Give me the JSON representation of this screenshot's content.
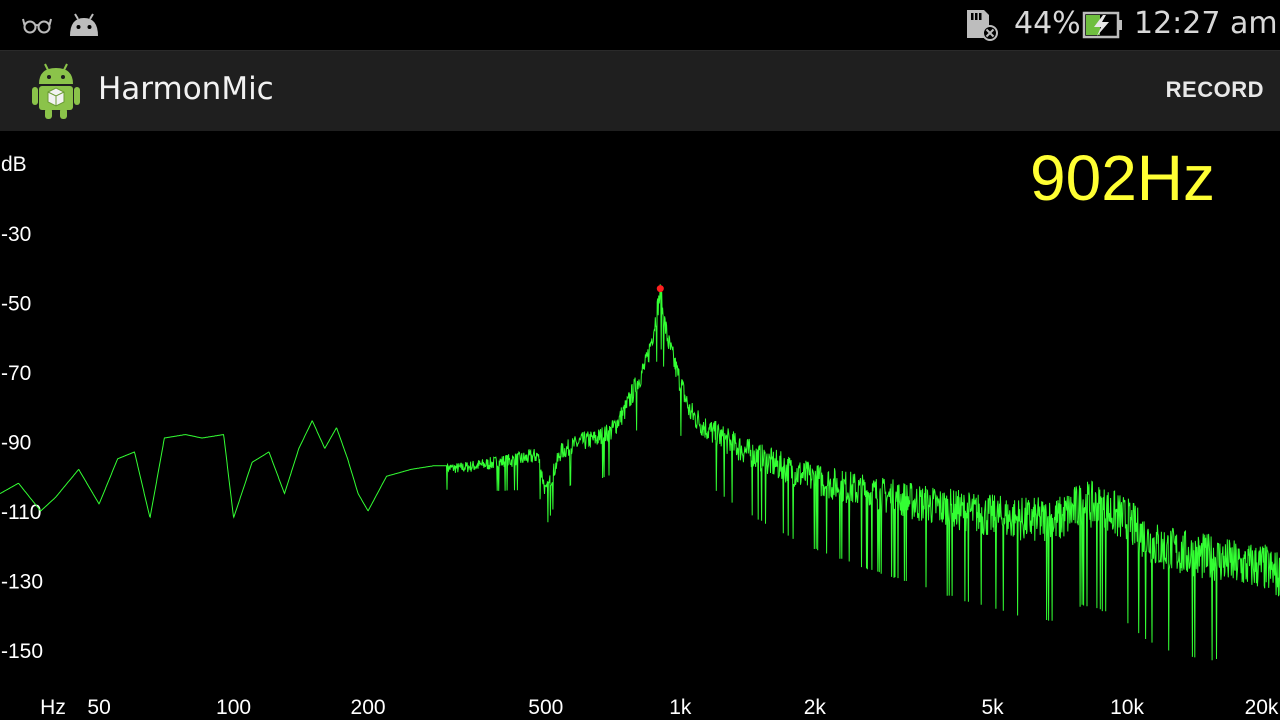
{
  "status_bar": {
    "battery_percent": "44%",
    "time": "12:27 am",
    "icons": [
      "glasses-icon",
      "android-notification-icon",
      "sdcard-error-icon",
      "battery-charging-icon"
    ]
  },
  "action_bar": {
    "title": "HarmonMic",
    "record_label": "RECORD",
    "logo_icon": "android-robot-icon"
  },
  "readout": {
    "frequency": "902Hz"
  },
  "colors": {
    "spectrum": "#33ff33",
    "peak_marker": "#ff2020",
    "frequency_readout": "#ffff33",
    "background": "#000000",
    "action_bar": "#1f1f1f"
  },
  "chart_data": {
    "type": "line",
    "title": "",
    "xlabel": "Hz",
    "ylabel": "dB",
    "x_scale": "log",
    "x_ticks": [
      "50",
      "100",
      "200",
      "500",
      "1k",
      "2k",
      "5k",
      "10k",
      "20k"
    ],
    "x_tick_values": [
      50,
      100,
      200,
      500,
      1000,
      2000,
      5000,
      10000,
      20000
    ],
    "y_ticks": [
      "-30",
      "-50",
      "-70",
      "-90",
      "-110",
      "-130",
      "-150"
    ],
    "y_tick_values": [
      -30,
      -50,
      -70,
      -90,
      -110,
      -130,
      -150
    ],
    "xlim": [
      30,
      22000
    ],
    "ylim": [
      -160,
      -10
    ],
    "grid": false,
    "peak": {
      "x": 902,
      "y": -46
    },
    "series": [
      {
        "x": [
          30,
          33,
          37,
          40,
          45,
          50,
          55,
          60,
          65,
          70,
          78,
          85,
          95,
          100,
          110,
          120,
          130,
          140,
          150,
          160,
          170,
          180,
          190,
          200,
          220,
          250,
          280,
          320,
          360,
          400,
          450,
          480,
          500,
          540,
          600,
          650,
          700,
          750,
          800,
          840,
          870,
          890,
          902,
          915,
          940,
          980,
          1050,
          1150,
          1300,
          1500,
          1800,
          2000,
          2500,
          3000,
          4000,
          5000,
          6000,
          7000,
          8000,
          9000,
          10000,
          11000,
          12000,
          14000,
          16000,
          18000,
          20000,
          22000
        ],
        "y": [
          -105,
          -102,
          -110,
          -106,
          -98,
          -108,
          -95,
          -93,
          -112,
          -89,
          -88,
          -89,
          -88,
          -112,
          -96,
          -93,
          -105,
          -92,
          -84,
          -92,
          -86,
          -95,
          -105,
          -110,
          -100,
          -98,
          -97,
          -97,
          -96,
          -95,
          -94,
          -93,
          -104,
          -92,
          -89,
          -88,
          -86,
          -80,
          -72,
          -66,
          -57,
          -50,
          -46,
          -52,
          -60,
          -68,
          -80,
          -85,
          -89,
          -93,
          -97,
          -99,
          -102,
          -104,
          -107,
          -109,
          -110,
          -110,
          -105,
          -107,
          -110,
          -115,
          -118,
          -120,
          -121,
          -123,
          -123,
          -126
        ]
      }
    ]
  }
}
